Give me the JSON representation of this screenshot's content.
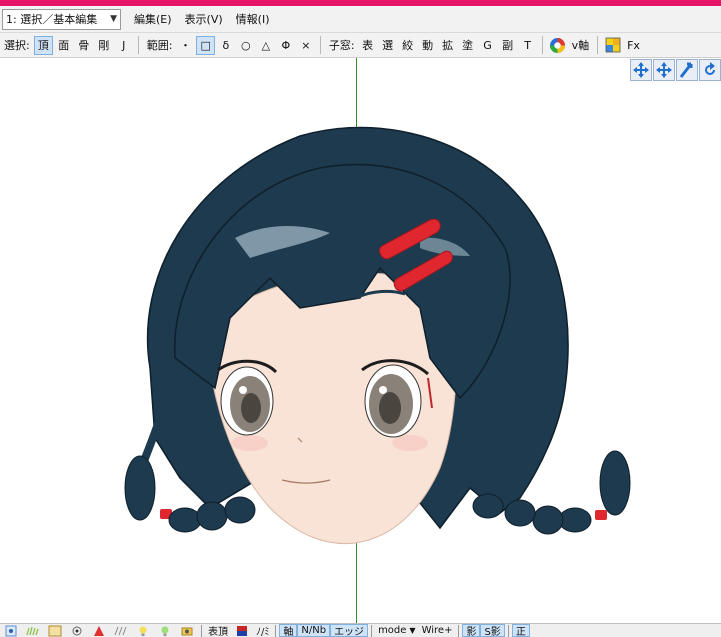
{
  "menubar": {
    "mode_select": "1: 選択／基本編集",
    "items": [
      {
        "label": "編集(E)"
      },
      {
        "label": "表示(V)"
      },
      {
        "label": "情報(I)"
      }
    ]
  },
  "toolbar": {
    "select_label": "選択:",
    "select_items": [
      {
        "label": "頂",
        "active": true
      },
      {
        "label": "面",
        "active": false
      },
      {
        "label": "骨",
        "active": false
      },
      {
        "label": "剛",
        "active": false
      },
      {
        "label": "J",
        "active": false
      }
    ],
    "range_label": "範囲:",
    "range_items": [
      {
        "label": "・",
        "active": false
      },
      {
        "label": "□",
        "active": true
      },
      {
        "label": "δ",
        "active": false
      },
      {
        "label": "○",
        "active": false
      },
      {
        "label": "△",
        "active": false
      },
      {
        "label": "Φ",
        "active": false
      },
      {
        "label": "×",
        "active": false
      }
    ],
    "subwin_label": "子窓:",
    "subwin_items": [
      {
        "label": "表"
      },
      {
        "label": "選"
      },
      {
        "label": "絞"
      },
      {
        "label": "動"
      },
      {
        "label": "拡"
      },
      {
        "label": "塗"
      },
      {
        "label": "G"
      },
      {
        "label": "副"
      },
      {
        "label": "T"
      }
    ],
    "vaxis_label": "v軸",
    "fx_label": "Fx"
  },
  "viewport": {
    "view_buttons": [
      {
        "icon": "move-view-icon"
      },
      {
        "icon": "pan-view-icon"
      },
      {
        "icon": "zoom-view-icon"
      },
      {
        "icon": "rotate-view-icon"
      }
    ]
  },
  "statusbar": {
    "table_label": "表頂",
    "slash_label": "ﾉ/ﾐ",
    "axis_label": "軸",
    "normal_label": "N/Nb",
    "edge_label": "エッジ",
    "mode_label": "mode",
    "wire_label": "Wire+",
    "shadow_label": "影",
    "sshadow_label": "S影",
    "front_label": "正"
  },
  "colors": {
    "accent": "#e6136b",
    "axis": "#2f8f2f",
    "hair": "#1d3a4e",
    "skin": "#f9e3d6",
    "clip": "#e0262e"
  }
}
